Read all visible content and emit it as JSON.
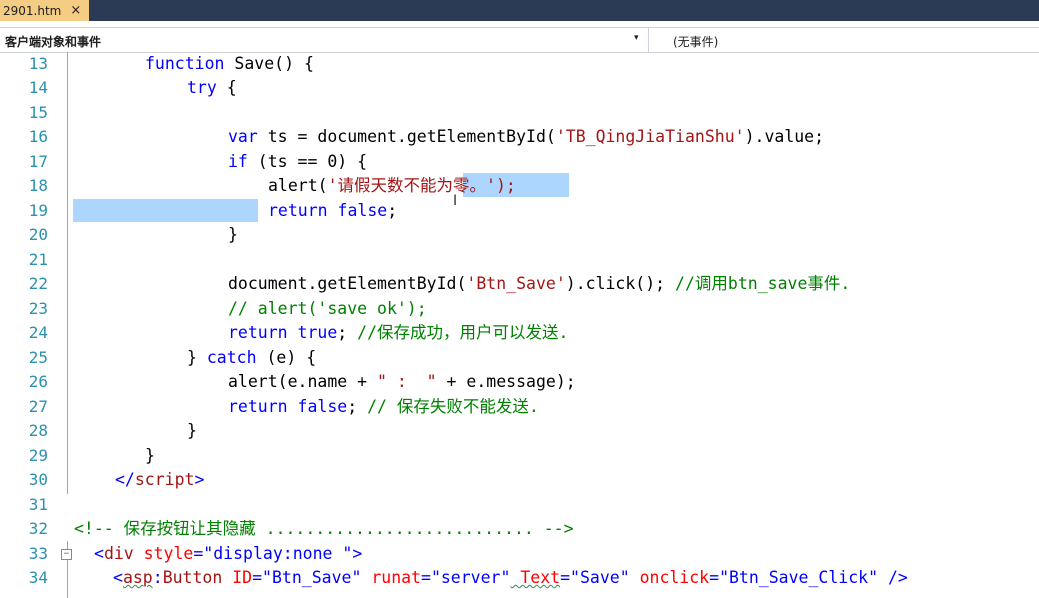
{
  "tab": {
    "title": "2901.htm",
    "close": "×"
  },
  "navbar": {
    "left_dropdown": "客户端对象和事件",
    "right_dropdown": "(无事件)"
  },
  "editor": {
    "line_numbers": [
      "13",
      "14",
      "15",
      "16",
      "17",
      "18",
      "19",
      "20",
      "21",
      "22",
      "23",
      "24",
      "25",
      "26",
      "27",
      "28",
      "29",
      "30",
      "31",
      "32",
      "33",
      "34"
    ],
    "lines": {
      "l13": {
        "kw": "function",
        "rest": " Save() {"
      },
      "l14": {
        "kw": "try",
        "rest": " {"
      },
      "l16": {
        "kw": "var",
        "a": " ts = document.getElementById(",
        "str": "'TB_QingJiaTianShu'",
        "b": ").value;"
      },
      "l17": {
        "kw": "if",
        "rest": " (ts == 0) {"
      },
      "l18": {
        "a": "alert(",
        "str_a": "'请假天数不能",
        "str_sel": "为零。');",
        "b": ""
      },
      "l19": {
        "kw": "return",
        "kw2": " false",
        "rest": ";"
      },
      "l20": {
        "rest": "}"
      },
      "l22": {
        "a": "document.getElementById(",
        "str": "'Btn_Save'",
        "b": ").click(); ",
        "cm": "//调用btn_save事件."
      },
      "l23": {
        "cm": "// alert('save ok');"
      },
      "l24": {
        "kw": "return",
        "kw2": " true",
        "rest": "; ",
        "cm": "//保存成功，用户可以发送."
      },
      "l25": {
        "a": "} ",
        "kw": "catch",
        "b": " (e) {"
      },
      "l26": {
        "a": "alert(e.name + ",
        "str": "\" :  \"",
        "b": " + e.message);"
      },
      "l27": {
        "kw": "return",
        "kw2": " false",
        "rest": "; ",
        "cm": "// 保存失败不能发送."
      },
      "l28": {
        "rest": "}"
      },
      "l29": {
        "rest": "}"
      },
      "l30": {
        "br1": "</",
        "tag": "script",
        "br2": ">"
      },
      "l32": {
        "cm": "<!-- 保存按钮让其隐藏 ........................... -->"
      },
      "l33": {
        "br1": "<",
        "tag": "div",
        "attr": " style",
        "eq": "=",
        "val": "\"display:none \"",
        "br2": ">"
      },
      "l34": {
        "br1": "<",
        "tag1": "asp",
        "colon": ":",
        "tag2": "Button",
        "a1": " ID",
        "v1": "\"Btn_Save\"",
        "a2": " runat",
        "v2": "\"server\"",
        "a3": " Text",
        "v3": "\"Save\"",
        "a4": " onclick",
        "v4": "\"Btn_Save_Click\"",
        "br2": " />"
      }
    }
  }
}
